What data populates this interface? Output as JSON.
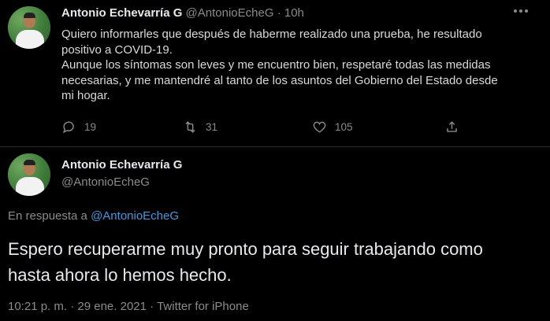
{
  "tweet1": {
    "author_name": "Antonio Echevarría G",
    "handle": "@AntonioEcheG",
    "separator": "·",
    "time": "10h",
    "text_line1": "Quiero informarles que después de haberme realizado una prueba, he resultado positivo a COVID-19.",
    "text_line2": "Aunque los síntomas son leves y me encuentro bien, respetaré todas las medidas necesarias, y me mantendré al tanto de los asuntos del Gobierno del Estado desde mi hogar.",
    "replies": "19",
    "retweets": "31",
    "likes": "105",
    "icons": [
      "reply-icon",
      "retweet-icon",
      "like-icon",
      "share-icon"
    ]
  },
  "tweet2": {
    "author_name": "Antonio Echevarría G",
    "handle": "@AntonioEcheG",
    "reply_prefix": "En respuesta a",
    "reply_to": "@AntonioEcheG",
    "text": "Espero recuperarme muy pronto para seguir trabajando como hasta ahora lo hemos hecho.",
    "time": "10:21 p. m.",
    "date": "29 ene. 2021",
    "source": "Twitter for iPhone"
  },
  "colors": {
    "background": "#000000",
    "link": "#3f9be0",
    "muted": "#8b8b8b",
    "divider": "#2a2a2a"
  }
}
